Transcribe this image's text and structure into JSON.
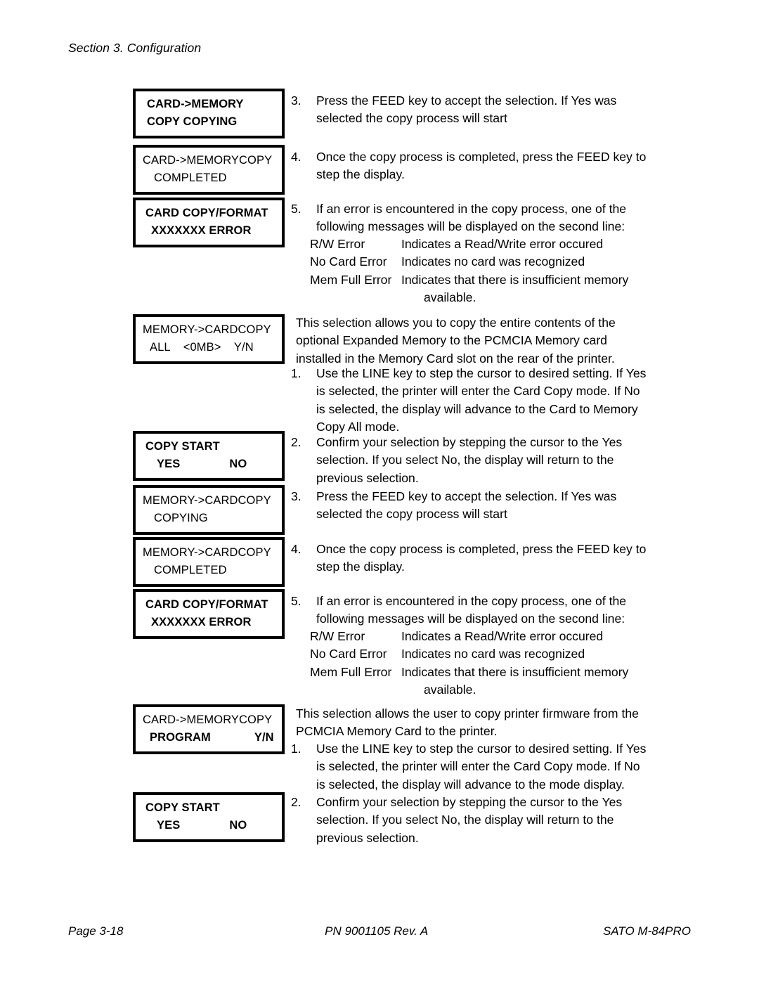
{
  "header": {
    "section": "Section 3. Configuration"
  },
  "footer": {
    "page": "Page 3-18",
    "part_number": "PN 9001105 Rev. A",
    "model": "SATO M-84PRO"
  },
  "lcd_displays": [
    {
      "name": "card-to-memory-copy-copying",
      "line1": "CARD->MEMORY",
      "line2": "COPY COPYING"
    },
    {
      "name": "card-to-memory-copy-completed",
      "line1": "CARD->MEMORYCOPY",
      "line2": "COMPLETED"
    },
    {
      "name": "card-copy-format-error-1",
      "line1": "CARD COPY/FORMAT",
      "line2": "XXXXXXX ERROR"
    },
    {
      "name": "memory-to-card-copy-all",
      "line1": "MEMORY->CARDCOPY",
      "line2": "ALL    <0MB>    Y/N"
    },
    {
      "name": "copy-start-yes-no-1",
      "line1": "COPY START",
      "line2a": "YES",
      "line2b": "NO"
    },
    {
      "name": "memory-to-card-copy-copying",
      "line1": "MEMORY->CARDCOPY",
      "line2": "COPYING"
    },
    {
      "name": "memory-to-card-copy-completed",
      "line1": "MEMORY->CARDCOPY",
      "line2": "COMPLETED"
    },
    {
      "name": "card-copy-format-error-2",
      "line1": "CARD COPY/FORMAT",
      "line2": "XXXXXXX ERROR"
    },
    {
      "name": "card-to-memory-copy-program",
      "line1": "CARD->MEMORYCOPY",
      "line2a": "PROGRAM",
      "line2b": "Y/N"
    },
    {
      "name": "copy-start-yes-no-2",
      "line1": "COPY START",
      "line2a": "YES",
      "line2b": "NO"
    }
  ],
  "steps": {
    "s3_num": "3.",
    "s3_text": "Press the FEED key to accept the selection. If Yes was selected the copy process will start",
    "s4_num": "4.",
    "s4_text": "Once the copy process is completed, press the FEED key to step the display.",
    "s5_num": "5.",
    "s5_text": "If an error is encountered in the copy process, one of the following messages will be displayed on the second line:",
    "s1b_num": "1.",
    "s1b_text": "Use the LINE key to step the cursor to desired setting. If Yes is selected, the printer will enter the Card Copy mode. If No is selected, the display will advance to the Card to Memory Copy All mode.",
    "s2b_num": "2.",
    "s2b_text": "Confirm your selection by stepping the cursor to the Yes selection. If you select No, the display will return to the previous selection.",
    "s3b_num": "3.",
    "s3b_text": "Press the FEED key to accept the selection. If Yes was selected the copy process will start",
    "s4b_num": "4.",
    "s4b_text": "Once the copy process is completed, press the FEED key to step the display.",
    "s5b_num": "5.",
    "s5b_text": "If an error is encountered in the copy process, one of the following messages will be displayed on the second line:",
    "s1c_num": "1.",
    "s1c_text": "Use the LINE key to step the cursor to desired setting. If Yes is selected, the printer will enter the Card Copy mode. If No is selected, the display will advance to the mode display.",
    "s2c_num": "2.",
    "s2c_text": "Confirm your selection by stepping the cursor to the Yes selection. If you select No, the display will return to the previous selection."
  },
  "error_list_1": [
    {
      "term": "R/W Error",
      "desc": "Indicates a Read/Write error occured",
      "cont": ""
    },
    {
      "term": "No Card Error",
      "desc": "Indicates no card was recognized",
      "cont": ""
    },
    {
      "term": "Mem Full Error",
      "desc": "Indicates that there is insufficient memory",
      "cont": "available."
    }
  ],
  "error_list_2": [
    {
      "term": "R/W Error",
      "desc": "Indicates a Read/Write error occured",
      "cont": ""
    },
    {
      "term": "No Card Error",
      "desc": "Indicates no card was recognized",
      "cont": ""
    },
    {
      "term": "Mem Full Error",
      "desc": "Indicates that there is insufficient memory",
      "cont": "available."
    }
  ],
  "descriptions": {
    "memory_to_card_all": "This selection allows you to copy the entire contents of the optional Expanded Memory to the PCMCIA Memory card installed in the Memory Card slot on the rear of the printer.",
    "card_to_memory_program": "This selection allows the user to copy printer firmware from the PCMCIA Memory Card to the printer."
  }
}
